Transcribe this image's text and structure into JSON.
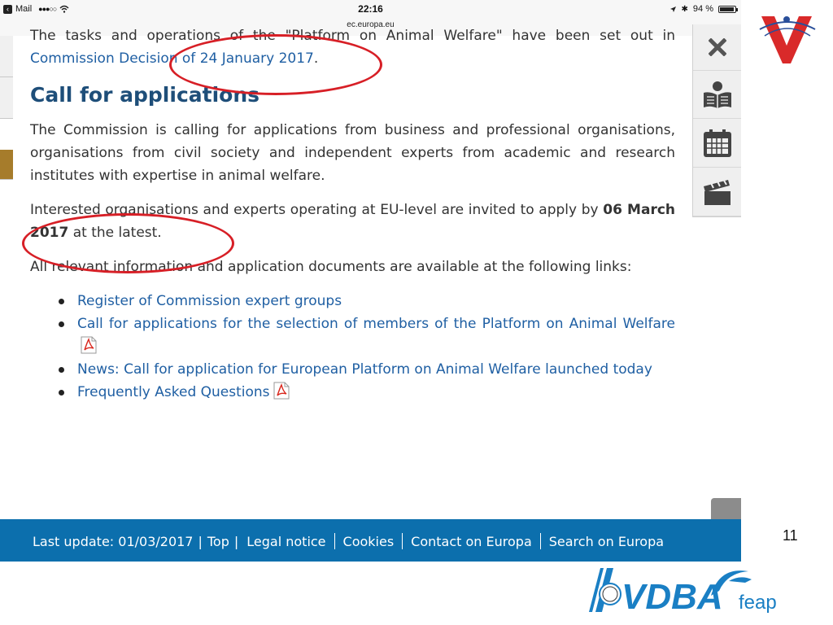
{
  "status_bar": {
    "back_app": "Mail",
    "signal": "●●●○○",
    "time": "22:16",
    "url": "ec.europa.eu",
    "battery": "94 %",
    "battery_level": 0.94
  },
  "content": {
    "intro_text": "The tasks and operations of the \"Platform on Animal Welfare\" have been set out in",
    "intro_link": "Commission Decision of 24 January 2017",
    "intro_tail": ".",
    "heading": "Call for applications",
    "para1": "The Commission is calling for applications from business and professional organisations, organisations from civil society and independent experts from academic and research institutes with expertise in animal welfare.",
    "para2_start": "Interested organisations and experts operating at EU-level are invited to apply by ",
    "para2_bold": "06 March 2017",
    "para2_end": " at the latest.",
    "para3": "All relevant information and application documents are available at the following links:",
    "links": [
      "Register of Commission expert groups",
      "Call for applications for the selection of members of the Platform on Animal Welfare",
      "News: Call for application for European Platform on Animal Welfare launched today",
      "Frequently Asked Questions"
    ]
  },
  "toolbar": {
    "icons": [
      "close-icon",
      "reader-icon",
      "calendar-icon",
      "video-icon"
    ]
  },
  "footer": {
    "last_update": "Last update: 01/03/2017",
    "sep_text": "|",
    "top": "Top",
    "top_sep": "|",
    "legal": "Legal notice",
    "cookies": "Cookies",
    "contact": "Contact on Europa",
    "search": "Search on Europa"
  },
  "slide_number": "11",
  "logos": {
    "bottom_left_text": "VDBA",
    "bottom_right_text": "feap"
  },
  "colors": {
    "accent_link": "#1f5fa3",
    "heading": "#1e4e79",
    "footer_bg": "#0c6fad",
    "annotation": "#d71f26"
  }
}
